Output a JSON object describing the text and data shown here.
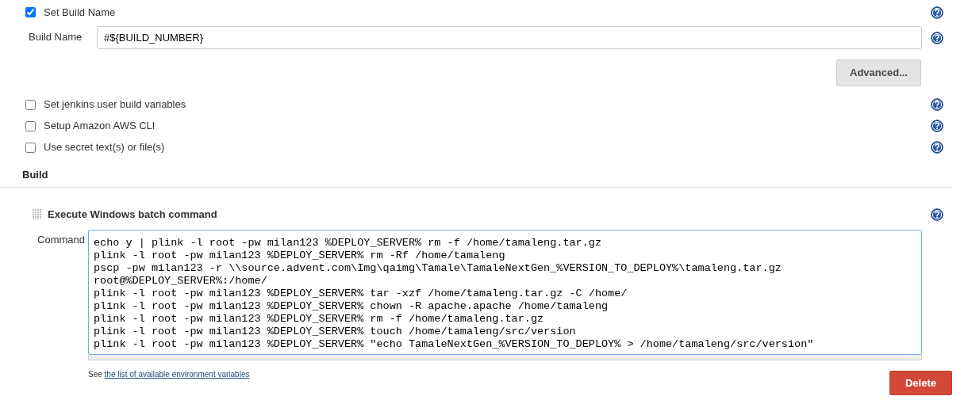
{
  "set_build_name": {
    "label": "Set Build Name",
    "checked": true,
    "build_name": {
      "label": "Build Name",
      "value": "#${BUILD_NUMBER}"
    },
    "advanced_button": "Advanced..."
  },
  "options": [
    {
      "label": "Set jenkins user build variables",
      "checked": false
    },
    {
      "label": "Setup Amazon AWS CLI",
      "checked": false
    },
    {
      "label": "Use secret text(s) or file(s)",
      "checked": false
    }
  ],
  "section_title": "Build",
  "build_step": {
    "title": "Execute Windows batch command",
    "command_label": "Command",
    "command_lines": [
      "echo y | plink -l root -pw milan123 %DEPLOY_SERVER% rm -f /home/tamaleng.tar.gz",
      "plink -l root -pw milan123 %DEPLOY_SERVER% rm -Rf /home/tamaleng",
      "pscp -pw milan123 -r \\\\source.advent.com\\Img\\qaimg\\Tamale\\TamaleNextGen_%VERSION_TO_DEPLOY%\\tamaleng.tar.gz",
      "root@%DEPLOY_SERVER%:/home/",
      "plink -l root -pw milan123 %DEPLOY_SERVER% tar -xzf /home/tamaleng.tar.gz -C /home/",
      "plink -l root -pw milan123 %DEPLOY_SERVER% chown -R apache.apache /home/tamaleng",
      "plink -l root -pw milan123 %DEPLOY_SERVER% rm -f /home/tamaleng.tar.gz",
      "plink -l root -pw milan123 %DEPLOY_SERVER% touch /home/tamaleng/src/version",
      "plink -l root -pw milan123 %DEPLOY_SERVER% \"echo TamaleNextGen_%VERSION_TO_DEPLOY% > /home/tamaleng/src/version\""
    ],
    "help_prefix": "See",
    "help_link": "the list of available environment variables",
    "delete_button": "Delete"
  }
}
